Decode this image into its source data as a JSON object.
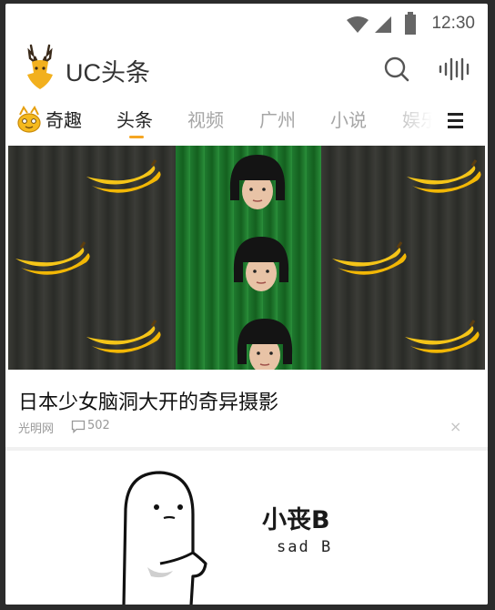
{
  "status_bar": {
    "time": "12:30"
  },
  "header": {
    "app_name": "UC头条"
  },
  "tabs": [
    {
      "label": "奇趣",
      "active": false,
      "icon": "mascot-icon"
    },
    {
      "label": "头条",
      "active": true
    },
    {
      "label": "视频",
      "active": false
    },
    {
      "label": "广州",
      "active": false
    },
    {
      "label": "小说",
      "active": false
    },
    {
      "label": "娱乐",
      "active": false
    }
  ],
  "article": {
    "title": "日本少女脑洞大开的奇异摄影",
    "source": "光明网",
    "comments": "502",
    "close_symbol": "×"
  },
  "card2": {
    "title": "小丧B",
    "subtitle": "sad B"
  },
  "colors": {
    "accent": "#f5a623",
    "logo": "#f2b01e",
    "curtain_green": "#1f7a2f",
    "banana": "#f5c518"
  }
}
